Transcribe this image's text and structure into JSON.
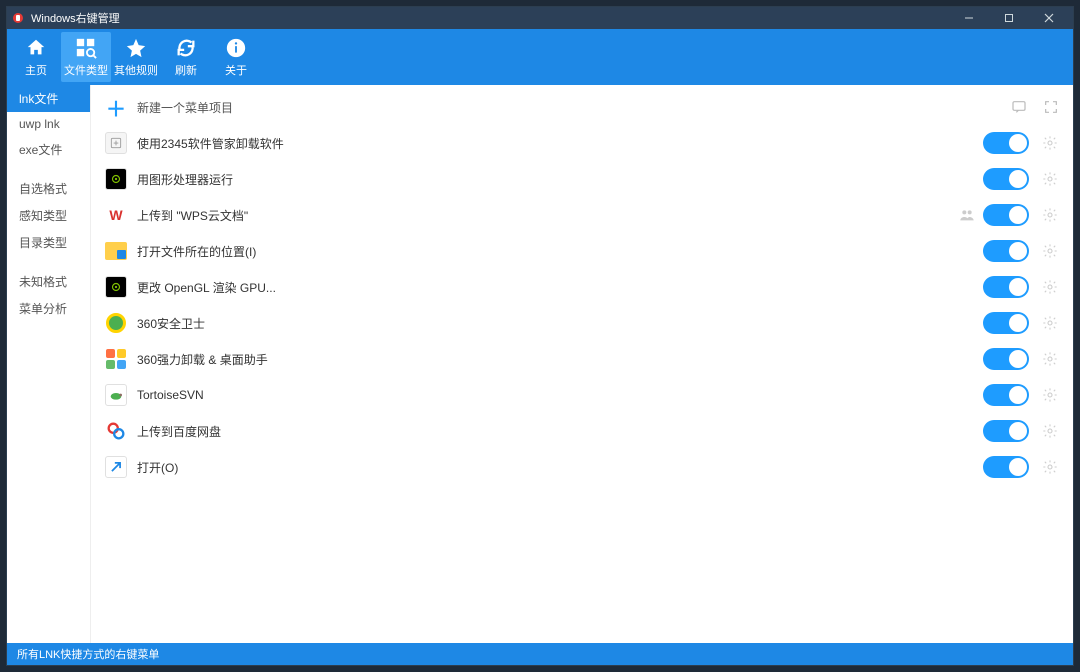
{
  "window": {
    "title": "Windows右键管理"
  },
  "toolbar": {
    "items": [
      {
        "id": "home",
        "label": "主页"
      },
      {
        "id": "filetype",
        "label": "文件类型"
      },
      {
        "id": "otherrules",
        "label": "其他规则"
      },
      {
        "id": "refresh",
        "label": "刷新"
      },
      {
        "id": "about",
        "label": "关于"
      }
    ],
    "activeIndex": 1
  },
  "sidebar": {
    "groups": [
      [
        "lnk文件",
        "uwp lnk",
        "exe文件"
      ],
      [
        "自选格式",
        "感知类型",
        "目录类型"
      ],
      [
        "未知格式",
        "菜单分析"
      ]
    ],
    "activeGroup": 0,
    "activeIndex": 0
  },
  "content": {
    "create_label": "新建一个菜单项目",
    "items": [
      {
        "label": "使用2345软件管家卸载软件",
        "icon": "uninstaller",
        "iconbg": "#f5f5f5",
        "iconcolor": "#888",
        "toggle": true
      },
      {
        "label": "用图形处理器运行",
        "icon": "nvidia",
        "iconbg": "#000",
        "iconcolor": "#7fbf00",
        "toggle": true
      },
      {
        "label": "上传到 \"WPS云文档\"",
        "icon": "wps",
        "iconbg": "#fff",
        "iconcolor": "#d9322e",
        "toggle": true,
        "extra": "persons"
      },
      {
        "label": "打开文件所在的位置(I)",
        "icon": "folder",
        "iconbg": "#ffcf4b",
        "iconcolor": "#1e88e5",
        "toggle": true
      },
      {
        "label": "更改 OpenGL 渲染 GPU...",
        "icon": "nvidia",
        "iconbg": "#000",
        "iconcolor": "#7fbf00",
        "toggle": true
      },
      {
        "label": "360安全卫士",
        "icon": "360",
        "iconbg": "#ffd400",
        "iconcolor": "#2e7d32",
        "toggle": true
      },
      {
        "label": "360强力卸载 & 桌面助手",
        "icon": "grid4",
        "iconbg": "#fff",
        "iconcolor": "",
        "toggle": true
      },
      {
        "label": "TortoiseSVN",
        "icon": "tortoise",
        "iconbg": "#fff",
        "iconcolor": "#4caf50",
        "toggle": true
      },
      {
        "label": "上传到百度网盘",
        "icon": "baidu",
        "iconbg": "#fff",
        "iconcolor": "#1e88e5",
        "toggle": true
      },
      {
        "label": "打开(O)",
        "icon": "shortcut",
        "iconbg": "#fff",
        "iconcolor": "#1e88e5",
        "toggle": true
      }
    ]
  },
  "statusbar": {
    "text": "所有LNK快捷方式的右键菜单"
  }
}
